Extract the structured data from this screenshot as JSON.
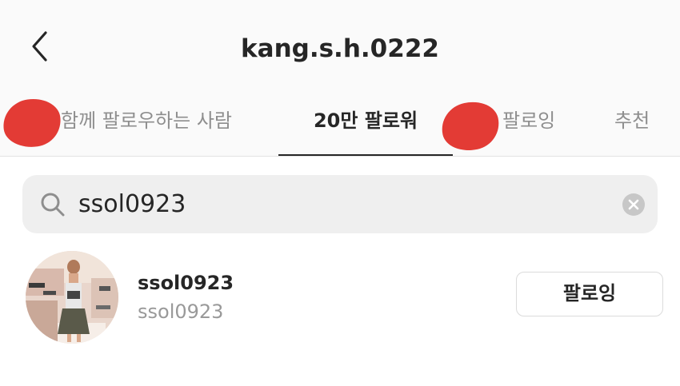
{
  "header": {
    "title": "kang.s.h.0222",
    "back_icon": "chevron-left-icon"
  },
  "tabs": [
    {
      "label": "함께 팔로우하는 사람",
      "active": false
    },
    {
      "label": "20만 팔로워",
      "active": true
    },
    {
      "label": "팔로잉",
      "active": false
    },
    {
      "label": "추천",
      "active": false
    }
  ],
  "search": {
    "value": "ssol0923",
    "icon": "search-icon",
    "clear_icon": "clear-icon"
  },
  "results": [
    {
      "username": "ssol0923",
      "full_name": "ssol0923",
      "button_label": "팔로잉"
    }
  ],
  "colors": {
    "redaction": "#e33b35",
    "text_primary": "#262626",
    "text_secondary": "#999999",
    "search_bg": "#efefef"
  }
}
